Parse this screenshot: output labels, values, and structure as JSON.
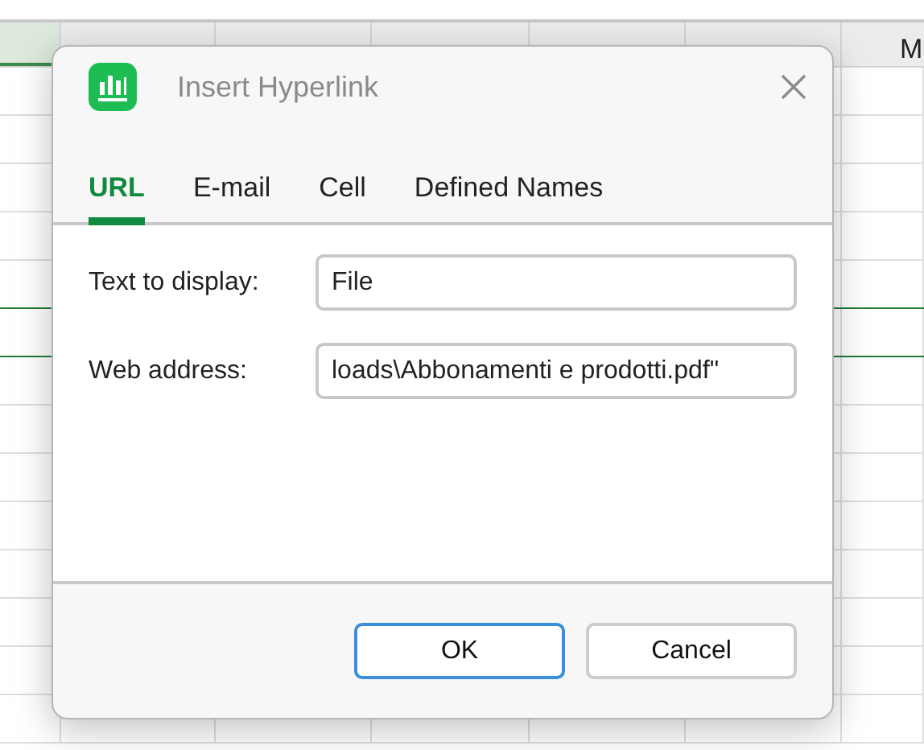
{
  "sheet": {
    "columns": [
      "M"
    ]
  },
  "dialog": {
    "title": "Insert Hyperlink",
    "tabs": [
      {
        "label": "URL",
        "selected": true
      },
      {
        "label": "E-mail",
        "selected": false
      },
      {
        "label": "Cell",
        "selected": false
      },
      {
        "label": "Defined Names",
        "selected": false
      }
    ],
    "fields": [
      {
        "label": "Text to display:",
        "value": "File"
      },
      {
        "label": "Web address:",
        "value": "loads\\Abbonamenti e prodotti.pdf\""
      }
    ],
    "buttons": [
      {
        "label": "OK",
        "default": true
      },
      {
        "label": "Cancel",
        "default": false
      }
    ]
  }
}
